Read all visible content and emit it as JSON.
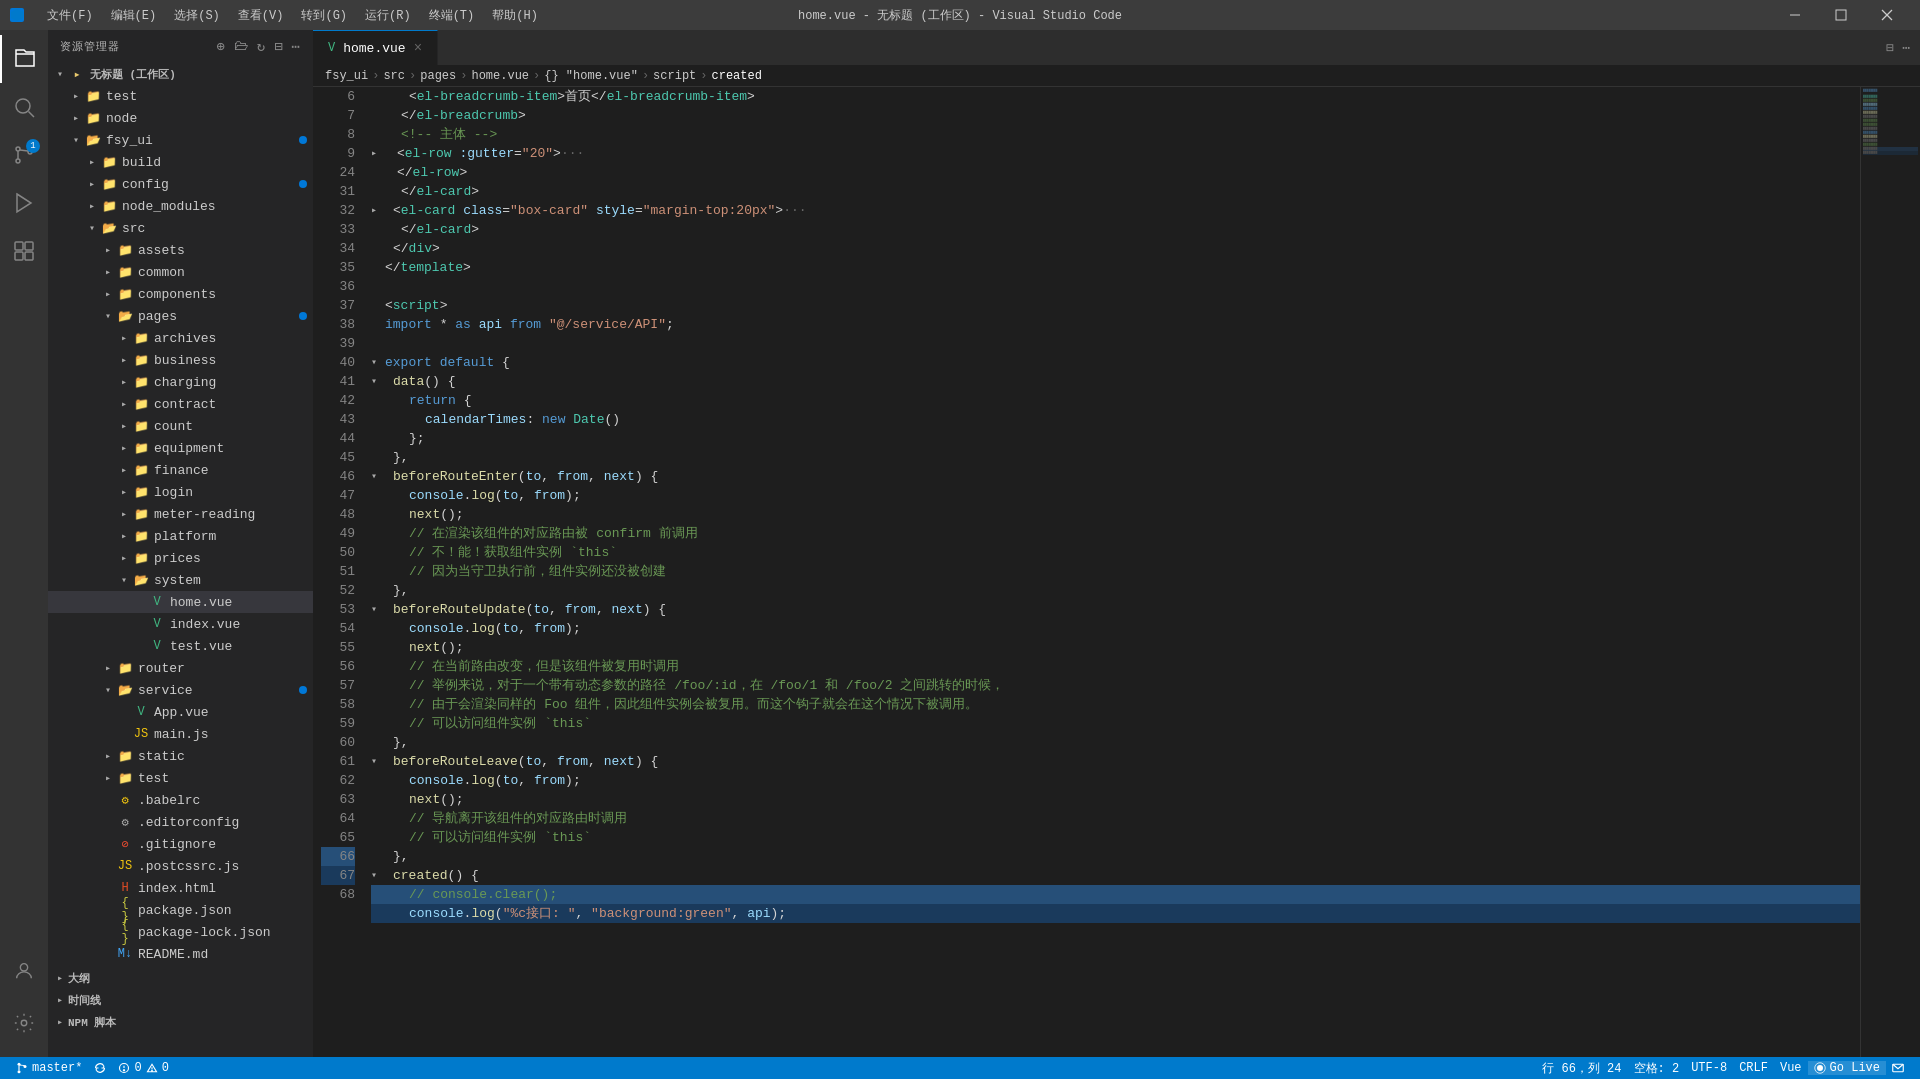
{
  "titleBar": {
    "icon": "◆",
    "menus": [
      "文件(F)",
      "编辑(E)",
      "选择(S)",
      "查看(V)",
      "转到(G)",
      "运行(R)",
      "终端(T)",
      "帮助(H)"
    ],
    "title": "home.vue - 无标题 (工作区) - Visual Studio Code",
    "controls": [
      "—",
      "❐",
      "✕"
    ]
  },
  "activityBar": {
    "items": [
      {
        "icon": "⎘",
        "name": "explorer-icon",
        "active": true
      },
      {
        "icon": "⌕",
        "name": "search-icon",
        "active": false
      },
      {
        "icon": "⎇",
        "name": "git-icon",
        "active": false,
        "badge": "1"
      },
      {
        "icon": "🐛",
        "name": "debug-icon",
        "active": false
      },
      {
        "icon": "⊞",
        "name": "extensions-icon",
        "active": false
      }
    ],
    "bottomItems": [
      {
        "icon": "👤",
        "name": "account-icon"
      },
      {
        "icon": "⚙",
        "name": "settings-icon"
      }
    ]
  },
  "sidebar": {
    "header": "资源管理器",
    "tree": [
      {
        "id": "workspace",
        "label": "无标题 (工作区)",
        "level": 0,
        "expanded": true,
        "type": "folder",
        "arrow": "▾"
      },
      {
        "id": "test-root",
        "label": "test",
        "level": 1,
        "expanded": false,
        "type": "folder",
        "arrow": "▸"
      },
      {
        "id": "node",
        "label": "node",
        "level": 1,
        "expanded": false,
        "type": "folder",
        "arrow": "▸"
      },
      {
        "id": "fsy_ui",
        "label": "fsy_ui",
        "level": 1,
        "expanded": true,
        "type": "folder",
        "arrow": "▾",
        "dot": true
      },
      {
        "id": "build",
        "label": "build",
        "level": 2,
        "expanded": false,
        "type": "folder",
        "arrow": "▸"
      },
      {
        "id": "config",
        "label": "config",
        "level": 2,
        "expanded": false,
        "type": "folder",
        "arrow": "▸",
        "dot": true
      },
      {
        "id": "node_modules",
        "label": "node_modules",
        "level": 2,
        "expanded": false,
        "type": "folder",
        "arrow": "▸"
      },
      {
        "id": "src",
        "label": "src",
        "level": 2,
        "expanded": true,
        "type": "folder",
        "arrow": "▾"
      },
      {
        "id": "assets",
        "label": "assets",
        "level": 3,
        "expanded": false,
        "type": "folder",
        "arrow": "▸"
      },
      {
        "id": "common",
        "label": "common",
        "level": 3,
        "expanded": false,
        "type": "folder",
        "arrow": "▸"
      },
      {
        "id": "components",
        "label": "components",
        "level": 3,
        "expanded": false,
        "type": "folder",
        "arrow": "▸"
      },
      {
        "id": "pages",
        "label": "pages",
        "level": 3,
        "expanded": true,
        "type": "folder",
        "arrow": "▾",
        "dot": true
      },
      {
        "id": "archives",
        "label": "archives",
        "level": 4,
        "expanded": false,
        "type": "folder",
        "arrow": "▸"
      },
      {
        "id": "business",
        "label": "business",
        "level": 4,
        "expanded": false,
        "type": "folder",
        "arrow": "▸"
      },
      {
        "id": "charging",
        "label": "charging",
        "level": 4,
        "expanded": false,
        "type": "folder",
        "arrow": "▸"
      },
      {
        "id": "contract",
        "label": "contract",
        "level": 4,
        "expanded": false,
        "type": "folder",
        "arrow": "▸"
      },
      {
        "id": "count",
        "label": "count",
        "level": 4,
        "expanded": false,
        "type": "folder",
        "arrow": "▸"
      },
      {
        "id": "equipment",
        "label": "equipment",
        "level": 4,
        "expanded": false,
        "type": "folder",
        "arrow": "▸"
      },
      {
        "id": "finance",
        "label": "finance",
        "level": 4,
        "expanded": false,
        "type": "folder",
        "arrow": "▸"
      },
      {
        "id": "login",
        "label": "login",
        "level": 4,
        "expanded": false,
        "type": "folder",
        "arrow": "▸"
      },
      {
        "id": "meter-reading",
        "label": "meter-reading",
        "level": 4,
        "expanded": false,
        "type": "folder",
        "arrow": "▸"
      },
      {
        "id": "platform",
        "label": "platform",
        "level": 4,
        "expanded": false,
        "type": "folder",
        "arrow": "▸"
      },
      {
        "id": "prices",
        "label": "prices",
        "level": 4,
        "expanded": false,
        "type": "folder",
        "arrow": "▸"
      },
      {
        "id": "system",
        "label": "system",
        "level": 4,
        "expanded": true,
        "type": "folder",
        "arrow": "▾"
      },
      {
        "id": "home-vue",
        "label": "home.vue",
        "level": 5,
        "type": "file",
        "active": true,
        "fileColor": "#41b883"
      },
      {
        "id": "index-vue",
        "label": "index.vue",
        "level": 5,
        "type": "file",
        "fileColor": "#41b883"
      },
      {
        "id": "test-vue",
        "label": "test.vue",
        "level": 5,
        "type": "file",
        "fileColor": "#41b883"
      },
      {
        "id": "router",
        "label": "router",
        "level": 3,
        "expanded": false,
        "type": "folder",
        "arrow": "▸"
      },
      {
        "id": "service",
        "label": "service",
        "level": 3,
        "expanded": false,
        "type": "folder",
        "arrow": "▸",
        "dot": true
      },
      {
        "id": "static",
        "label": "static",
        "level": 3,
        "expanded": false,
        "type": "folder",
        "arrow": "▸"
      },
      {
        "id": "test",
        "label": "test",
        "level": 3,
        "expanded": false,
        "type": "folder",
        "arrow": "▸"
      },
      {
        "id": "babelrc",
        "label": ".babelrc",
        "level": 3,
        "type": "file"
      },
      {
        "id": "editorconfig",
        "label": ".editorconfig",
        "level": 3,
        "type": "file"
      },
      {
        "id": "gitignore",
        "label": ".gitignore",
        "level": 3,
        "type": "file"
      },
      {
        "id": "postcssrc",
        "label": ".postcssrc.js",
        "level": 3,
        "type": "file"
      },
      {
        "id": "indexhtml",
        "label": "index.html",
        "level": 3,
        "type": "file"
      },
      {
        "id": "packagejson",
        "label": "package.json",
        "level": 3,
        "type": "file"
      },
      {
        "id": "packagelockjson",
        "label": "package-lock.json",
        "level": 3,
        "type": "file"
      },
      {
        "id": "readmemd",
        "label": "README.md",
        "level": 3,
        "type": "file"
      },
      {
        "id": "service-app",
        "label": "App.vue",
        "level": 4,
        "type": "file",
        "fileColor": "#41b883"
      },
      {
        "id": "service-main",
        "label": "main.js",
        "level": 4,
        "type": "file",
        "fileColor": "#f1c40f"
      }
    ]
  },
  "tabs": [
    {
      "label": "home.vue",
      "active": true,
      "icon": "V"
    }
  ],
  "breadcrumb": {
    "items": [
      "fsy_ui",
      "src",
      "pages",
      "home.vue",
      "{} \"home.vue\"",
      "script",
      "created"
    ]
  },
  "statusBar": {
    "left": [
      {
        "text": "⎇ master*",
        "name": "git-branch"
      },
      {
        "text": "⟳",
        "name": "sync-icon"
      },
      {
        "text": "⊗ 0 △ 0",
        "name": "errors-warnings"
      }
    ],
    "right": [
      {
        "text": "行 66，列 24",
        "name": "cursor-position"
      },
      {
        "text": "空格: 2",
        "name": "indent"
      },
      {
        "text": "UTF-8",
        "name": "encoding"
      },
      {
        "text": "CRLF",
        "name": "line-ending"
      },
      {
        "text": "Vue",
        "name": "language-mode"
      },
      {
        "text": "Go Live",
        "name": "golive"
      },
      {
        "text": "↑",
        "name": "upload-icon"
      }
    ]
  },
  "codeLines": [
    {
      "num": 6,
      "content": "el-breadcrumb",
      "indent": 12,
      "type": "html",
      "highlighted": false
    },
    {
      "num": 7,
      "content": "el-breadcrumb-close",
      "indent": 8,
      "type": "html",
      "highlighted": false
    },
    {
      "num": 8,
      "content": "comment-main",
      "indent": 8,
      "type": "comment",
      "highlighted": false
    },
    {
      "num": 9,
      "content": "el-row",
      "indent": 6,
      "type": "html",
      "highlighted": false,
      "folded": true
    },
    {
      "num": 24,
      "content": "el-row-close",
      "indent": 6,
      "type": "html",
      "highlighted": false
    },
    {
      "num": 31,
      "content": "el-card-close",
      "indent": 8,
      "type": "html",
      "highlighted": false
    },
    {
      "num": 32,
      "content": "div-close",
      "indent": 4,
      "type": "html",
      "highlighted": false
    },
    {
      "num": 33,
      "content": "template-close",
      "indent": 0,
      "type": "html",
      "highlighted": false
    },
    {
      "num": 34,
      "content": "",
      "indent": 0,
      "type": "blank",
      "highlighted": false
    },
    {
      "num": 35,
      "content": "script-open",
      "indent": 0,
      "type": "html",
      "highlighted": false
    },
    {
      "num": 36,
      "content": "import",
      "indent": 0,
      "type": "code",
      "highlighted": false
    },
    {
      "num": 37,
      "content": "",
      "indent": 0,
      "type": "blank",
      "highlighted": false
    },
    {
      "num": 38,
      "content": "export-default",
      "indent": 0,
      "type": "code",
      "highlighted": false
    },
    {
      "num": 39,
      "content": "data-fn",
      "indent": 2,
      "type": "code",
      "highlighted": false
    },
    {
      "num": 40,
      "content": "return-open",
      "indent": 4,
      "type": "code",
      "highlighted": false
    },
    {
      "num": 41,
      "content": "calendarTimes",
      "indent": 6,
      "type": "code",
      "highlighted": false
    },
    {
      "num": 42,
      "content": "obj-close",
      "indent": 4,
      "type": "code",
      "highlighted": false
    },
    {
      "num": 43,
      "content": "fn-close",
      "indent": 2,
      "type": "code",
      "highlighted": false
    },
    {
      "num": 44,
      "content": "beforeRouteEnter",
      "indent": 2,
      "type": "code",
      "highlighted": false
    },
    {
      "num": 45,
      "content": "console-log-1",
      "indent": 4,
      "type": "code",
      "highlighted": false
    },
    {
      "num": 46,
      "content": "next-call-1",
      "indent": 4,
      "type": "code",
      "highlighted": false
    },
    {
      "num": 47,
      "content": "comment1",
      "indent": 4,
      "type": "comment",
      "highlighted": false
    },
    {
      "num": 48,
      "content": "comment2",
      "indent": 4,
      "type": "comment",
      "highlighted": false
    },
    {
      "num": 49,
      "content": "comment3",
      "indent": 4,
      "type": "comment",
      "highlighted": false
    },
    {
      "num": 50,
      "content": "fn-close-2",
      "indent": 2,
      "type": "code",
      "highlighted": false
    },
    {
      "num": 51,
      "content": "beforeRouteUpdate",
      "indent": 2,
      "type": "code",
      "highlighted": false
    },
    {
      "num": 52,
      "content": "console-log-2",
      "indent": 4,
      "type": "code",
      "highlighted": false
    },
    {
      "num": 53,
      "content": "next-call-2",
      "indent": 4,
      "type": "code",
      "highlighted": false
    },
    {
      "num": 54,
      "content": "comment4",
      "indent": 4,
      "type": "comment",
      "highlighted": false
    },
    {
      "num": 55,
      "content": "comment5",
      "indent": 4,
      "type": "comment",
      "highlighted": false
    },
    {
      "num": 56,
      "content": "comment6",
      "indent": 4,
      "type": "comment",
      "highlighted": false
    },
    {
      "num": 57,
      "content": "comment7",
      "indent": 4,
      "type": "comment",
      "highlighted": false
    },
    {
      "num": 58,
      "content": "fn-close-3",
      "indent": 2,
      "type": "code",
      "highlighted": false
    },
    {
      "num": 59,
      "content": "beforeRouteLeave",
      "indent": 2,
      "type": "code",
      "highlighted": false
    },
    {
      "num": 60,
      "content": "console-log-3",
      "indent": 4,
      "type": "code",
      "highlighted": false
    },
    {
      "num": 61,
      "content": "next-call-3",
      "indent": 4,
      "type": "code",
      "highlighted": false
    },
    {
      "num": 62,
      "content": "comment8",
      "indent": 4,
      "type": "comment",
      "highlighted": false
    },
    {
      "num": 63,
      "content": "comment9",
      "indent": 4,
      "type": "comment",
      "highlighted": false
    },
    {
      "num": 64,
      "content": "fn-close-4",
      "indent": 2,
      "type": "code",
      "highlighted": false
    },
    {
      "num": 65,
      "content": "created-open",
      "indent": 2,
      "type": "code",
      "highlighted": false
    },
    {
      "num": 66,
      "content": "comment-clear",
      "indent": 4,
      "type": "comment",
      "highlighted": true
    },
    {
      "num": 67,
      "content": "console-green",
      "indent": 4,
      "type": "code",
      "highlighted": true
    }
  ]
}
